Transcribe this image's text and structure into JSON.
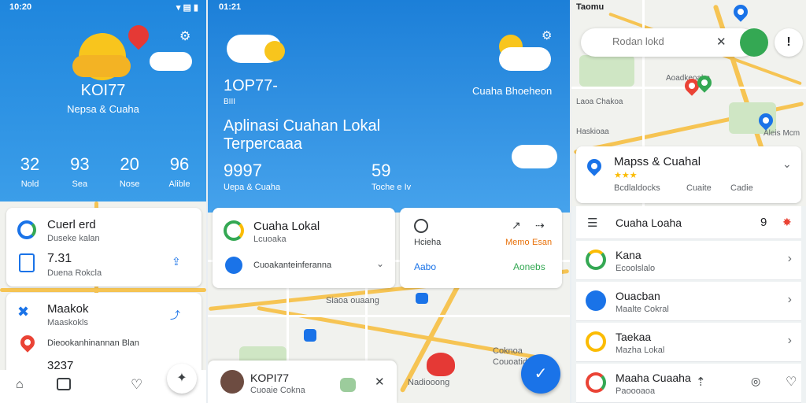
{
  "panel1": {
    "status_time": "10:20",
    "status_icons": "▾ ▤ ▮",
    "city": "KOI77",
    "subtitle": "Nepsa & Cuaha",
    "stats": [
      {
        "value": "32",
        "label": "Nold"
      },
      {
        "value": "93",
        "label": "Sea"
      },
      {
        "value": "20",
        "label": "Nose"
      },
      {
        "value": "96",
        "label": "Alible"
      }
    ],
    "card1": {
      "title": "Cuerl erd",
      "sub": "Duseke kalan",
      "value": "7.31",
      "value_sub": "Duena Rokcla"
    },
    "card2": {
      "title": "Maakok",
      "sub": "Maaskokls",
      "line": "Dieookanhinannan Blan",
      "value": "3237"
    }
  },
  "panel2": {
    "status_time": "01:21",
    "city": "1OP77-",
    "small": "BIII",
    "headline1": "Aplinasi Cuahan Lokal",
    "headline2": "Terpercaaa",
    "right_title": "Cuaha Bhoeheon",
    "big1": "9997",
    "big1_sub": "Uepa & Cuaha",
    "big2": "59",
    "big2_sub": "Toche e Iv",
    "card_a": {
      "title": "Cuaha Lokal",
      "sub": "Lcuoaka",
      "link": "Cuoakanteinferanna"
    },
    "card_b": {
      "title": "Hcieha",
      "label1": "Memo",
      "label2": "Esan",
      "left": "Aabo",
      "right": "Aonebs"
    },
    "map_labels": [
      "Siaoa ouaang",
      "Coknoa",
      "Couoatid",
      "Nadiooong"
    ],
    "bottom": {
      "title": "KOPI77",
      "sub": "Cuoaie Cokna"
    },
    "fab_glyph": "✓"
  },
  "panel3": {
    "status_time": "Taomu",
    "search_placeholder": "Rodan lokd",
    "map_labels": [
      "Laoa Chakoa",
      "Aoadkeoaha",
      "Haskioaa",
      "Aleis Mcm"
    ],
    "place": {
      "title": "Mapss & Cuahal",
      "rating": "★★★",
      "meta1": "Bcdlaldocks",
      "meta2": "Cuaite",
      "meta3": "Cadie"
    },
    "list_header": {
      "title": "Cuaha Loaha",
      "count": "9"
    },
    "items": [
      {
        "title": "Kana",
        "sub": "Ecoolslalo",
        "color": "#34a853"
      },
      {
        "title": "Ouacban",
        "sub": "Maalte Cokral",
        "color": "#1a73e8"
      },
      {
        "title": "Taekaa",
        "sub": "Mazha Lokal",
        "color": "#fbbc04"
      },
      {
        "title": "Maaha Cuaaha",
        "sub": "Paoooaoa",
        "color": "#ea4335"
      }
    ]
  },
  "colors": {
    "blue": "#1a73e8",
    "green": "#34a853",
    "red": "#ea4335",
    "yellow": "#fbbc04"
  }
}
